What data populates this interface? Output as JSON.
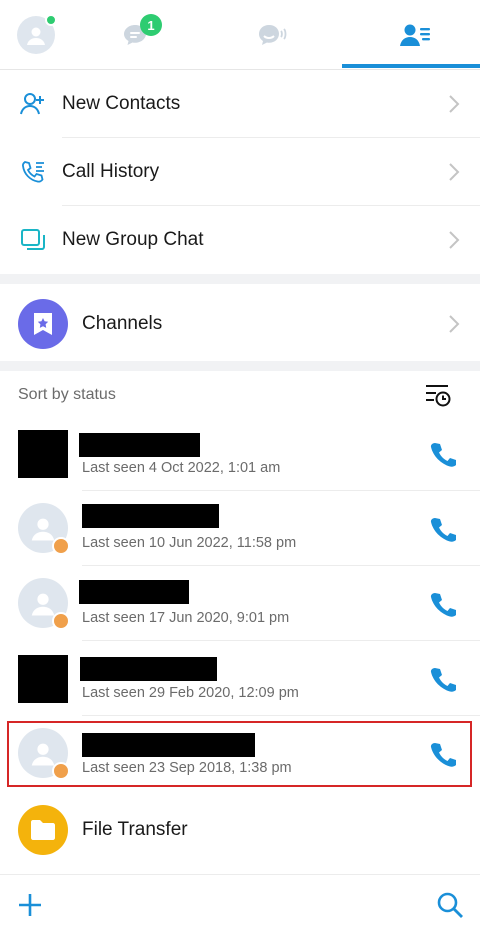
{
  "tabs": {
    "chats_badge": "1"
  },
  "menu": {
    "new_contacts": "New Contacts",
    "call_history": "Call History",
    "new_group_chat": "New Group Chat",
    "channels": "Channels"
  },
  "sort": {
    "label": "Sort by status"
  },
  "contacts": [
    {
      "last_seen": "Last seen 4 Oct 2022, 1:01 am",
      "avatar": "redacted"
    },
    {
      "last_seen": "Last seen 10 Jun 2022, 11:58 pm",
      "avatar": "default"
    },
    {
      "last_seen": "Last seen 17 Jun 2020, 9:01 pm",
      "avatar": "default"
    },
    {
      "last_seen": "Last seen 29 Feb 2020, 12:09 pm",
      "avatar": "redacted"
    },
    {
      "last_seen": "Last seen 23 Sep 2018, 1:38 pm",
      "avatar": "default"
    }
  ],
  "file_transfer": {
    "label": "File Transfer"
  },
  "colors": {
    "accent": "#1a8fd8",
    "badge_green": "#2ecc71",
    "channels_purple": "#6a6be8",
    "file_yellow": "#f4b30c",
    "clock_orange": "#f0a04b",
    "highlight_red": "#d62626"
  }
}
